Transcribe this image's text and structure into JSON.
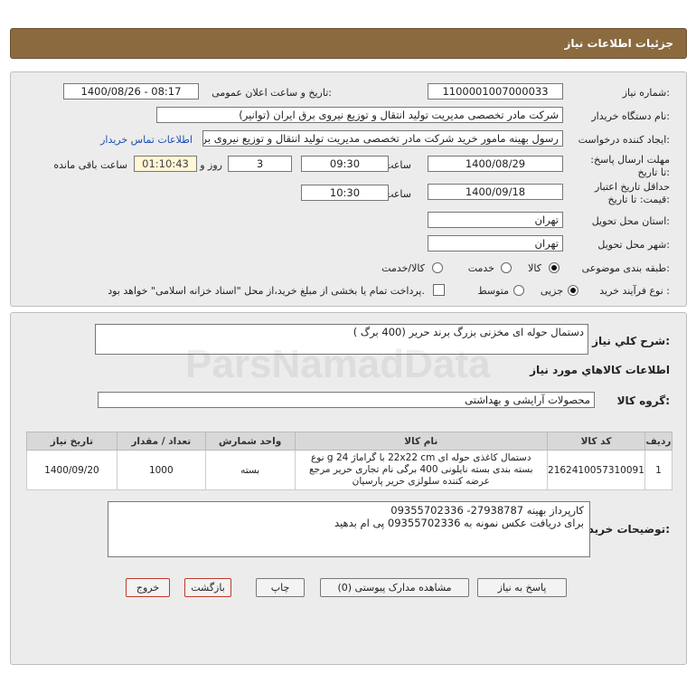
{
  "header": {
    "title": "جزئیات اطلاعات نیاز"
  },
  "form": {
    "need_number_label": "شماره نیاز:",
    "need_number": "1100001007000033",
    "announce_label": "تاریخ و ساعت اعلان عمومی:",
    "announce_value": "1400/08/26 - 08:17",
    "buyer_org_label": "نام دستگاه خریدار:",
    "buyer_org": "شرکت مادر تخصصی مدیریت تولید  انتقال و توزیع نیروی برق ایران (توانیر)",
    "requester_label": "ایجاد کننده درخواست:",
    "requester": "رسول بهینه مامور خرید شرکت مادر تخصصی مدیریت تولید  انتقال و توزیع نیروی برق ایران",
    "contact_link": "اطلاعات تماس خریدار",
    "reply_deadline_label": "مهلت ارسال پاسخ: تا تاریخ:",
    "reply_date": "1400/08/29",
    "time_label": "ساعت",
    "reply_time": "09:30",
    "days_value": "3",
    "days_label": "روز و",
    "remaining_time": "01:10:43",
    "remaining_label": "ساعت باقی مانده",
    "validity_label": "حداقل تاریخ اعتبار قیمت: تا تاریخ:",
    "validity_date": "1400/09/18",
    "validity_time": "10:30",
    "province_label": "استان محل تحویل:",
    "province": "تهران",
    "city_label": "شهر محل تحویل:",
    "city": "تهران",
    "category_label": "طبقه بندی موضوعی:",
    "category_options": [
      "کالا",
      "خدمت",
      "کالا/خدمت"
    ],
    "category_selected": "کالا",
    "process_label": "نوع فرآیند خرید :",
    "process_options": [
      "جزیی",
      "متوسط"
    ],
    "process_selected": "جزیی",
    "payment_text": "پرداخت تمام یا بخشی از مبلغ خرید،از محل \"اسناد خزانه اسلامی\" خواهد بود."
  },
  "summary": {
    "label": "شرح کلي نياز:",
    "value": "دستمال حوله ای مخزنی بزرگ برند حریر (400 برگ )"
  },
  "goods": {
    "section_title": "اطلاعات کالاهاي مورد نياز",
    "group_label": "گروه کالا:",
    "group_value": "محصولات آرایشی و بهداشتی",
    "columns": [
      "ردیف",
      "کد کالا",
      "نام کالا",
      "واحد شمارش",
      "تعداد / مقدار",
      "تاریخ نیاز"
    ],
    "rows": [
      {
        "index": "1",
        "code": "2162410057310091",
        "name": "دستمال کاغذی حوله ای 22x22 cm با گراماژ 24 g نوع بسته بندی بسته نایلونی 400 برگی نام تجاری حریر مرجع عرضه کننده سلولزی حریر پارسیان",
        "unit": "بسته",
        "qty": "1000",
        "date": "1400/09/20"
      }
    ]
  },
  "notes": {
    "label": "توضیحات خریدار:",
    "line1": "کارپرداز بهینه 27938787- 09355702336",
    "line2": "برای دریافت عکس نمونه به 09355702336 پی ام بدهید"
  },
  "buttons": {
    "reply": "پاسخ به نیاز",
    "attachments": "مشاهده مدارک پیوستی (0)",
    "print": "چاپ",
    "back": "بازگشت",
    "exit": "خروج"
  },
  "watermark": {
    "brand": "ParsNamadData"
  }
}
